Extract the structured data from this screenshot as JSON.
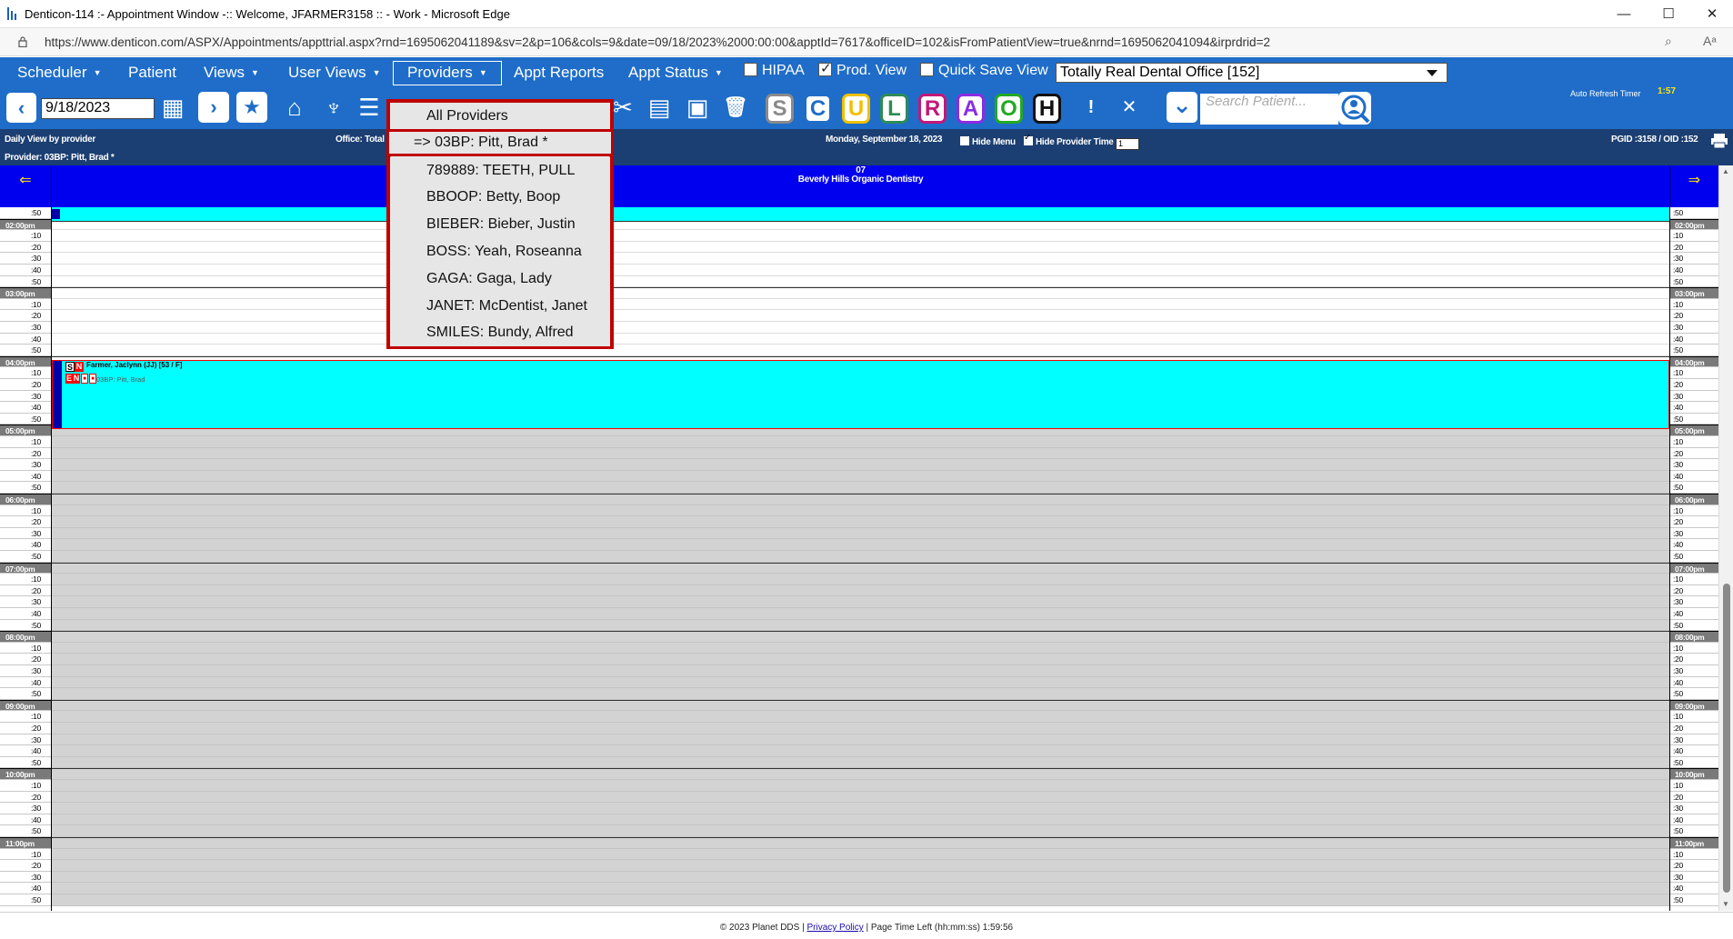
{
  "window": {
    "title": "Denticon-114 :- Appointment Window -:: Welcome, JFARMER3158 :: - Work - Microsoft Edge",
    "minimize": "—",
    "maximize": "☐",
    "close": "✕"
  },
  "address": {
    "url": "https://www.denticon.com/ASPX/Appointments/appttrial.aspx?rnd=1695062041189&sv=2&p=106&cols=9&date=09/18/2023%2000:00:00&apptId=7617&officeID=102&isFromPatientView=true&nrnd=1695062041094&irprdrid=2",
    "zoom_icon": "⌕",
    "read_icon": "Aᵃ"
  },
  "nav": {
    "scheduler": "Scheduler",
    "patient": "Patient",
    "views": "Views",
    "user_views": "User Views",
    "providers": "Providers",
    "appt_reports": "Appt Reports",
    "appt_status": "Appt Status",
    "hipaa": "HIPAA",
    "prod_view": "Prod. View",
    "quick_save": "Quick Save View",
    "office": "Totally Real Dental Office [152]",
    "caret": "▼"
  },
  "toolbar": {
    "date": "9/18/2023",
    "search_placeholder": "Search Patient...",
    "letters": [
      "S",
      "C",
      "U",
      "L",
      "R",
      "A",
      "O",
      "H"
    ],
    "letter_colors": [
      "#8a8a8a",
      "#1f6dc9",
      "#f0c000",
      "#2e8b57",
      "#c2187a",
      "#8b2be2",
      "#22aa22",
      "#111111"
    ],
    "refresh_label": "Auto Refresh Timer",
    "refresh_timer": "1:57",
    "icons": {
      "prev": "‹",
      "next": "›",
      "calendar": "▦",
      "star": "★",
      "home": "⌂",
      "tooth": "♆",
      "list": "☰",
      "scissors": "✂",
      "doc": "▤",
      "clipboard": "▣",
      "trash": "🗑",
      "alert": "!",
      "cancel": "✕",
      "collapse": "⌄",
      "user_search": "⚲"
    }
  },
  "info": {
    "daily_view": "Daily View by provider",
    "office_total": "Office: Total",
    "date_label": "Monday, September 18, 2023",
    "hide_menu": "Hide Menu",
    "hide_provider_time": "Hide Provider Time",
    "mini_select": "1",
    "pgid": "PGID :3158  /  OID :152",
    "provider": "Provider: 03BP: Pitt, Brad *"
  },
  "schedule": {
    "left_arrow": "⇐",
    "right_arrow": "⇒",
    "op_number": "07",
    "op_name": "Beverly Hills Organic Dentistry",
    "first_label": ":50",
    "hours": [
      "02:00pm",
      "03:00pm",
      "04:00pm",
      "05:00pm",
      "06:00pm",
      "07:00pm",
      "08:00pm",
      "09:00pm",
      "10:00pm",
      "11:00pm"
    ],
    "minutes": [
      ":10",
      ":20",
      ":30",
      ":40",
      ":50"
    ]
  },
  "appointment": {
    "patient": "Farmer, Jaclynn (JJ) [53 / F]",
    "provider": "03BP: Pitt, Brad",
    "badges": [
      "S",
      "N",
      "E",
      "N",
      "■",
      "■"
    ]
  },
  "footer": {
    "copyright": "© 2023 Planet DDS |",
    "privacy": "Privacy Policy",
    "time_left": "| Page Time Left (hh:mm:ss) 1:59:56"
  },
  "dropdown": {
    "options": [
      "All Providers",
      "=> 03BP: Pitt, Brad *",
      "789889: TEETH, PULL",
      "BBOOP: Betty, Boop",
      "BIEBER: Bieber, Justin",
      "BOSS: Yeah, Roseanna",
      "GAGA: Gaga, Lady",
      "JANET: McDentist, Janet",
      "SMILES: Bundy, Alfred"
    ],
    "selected_index": 1
  }
}
